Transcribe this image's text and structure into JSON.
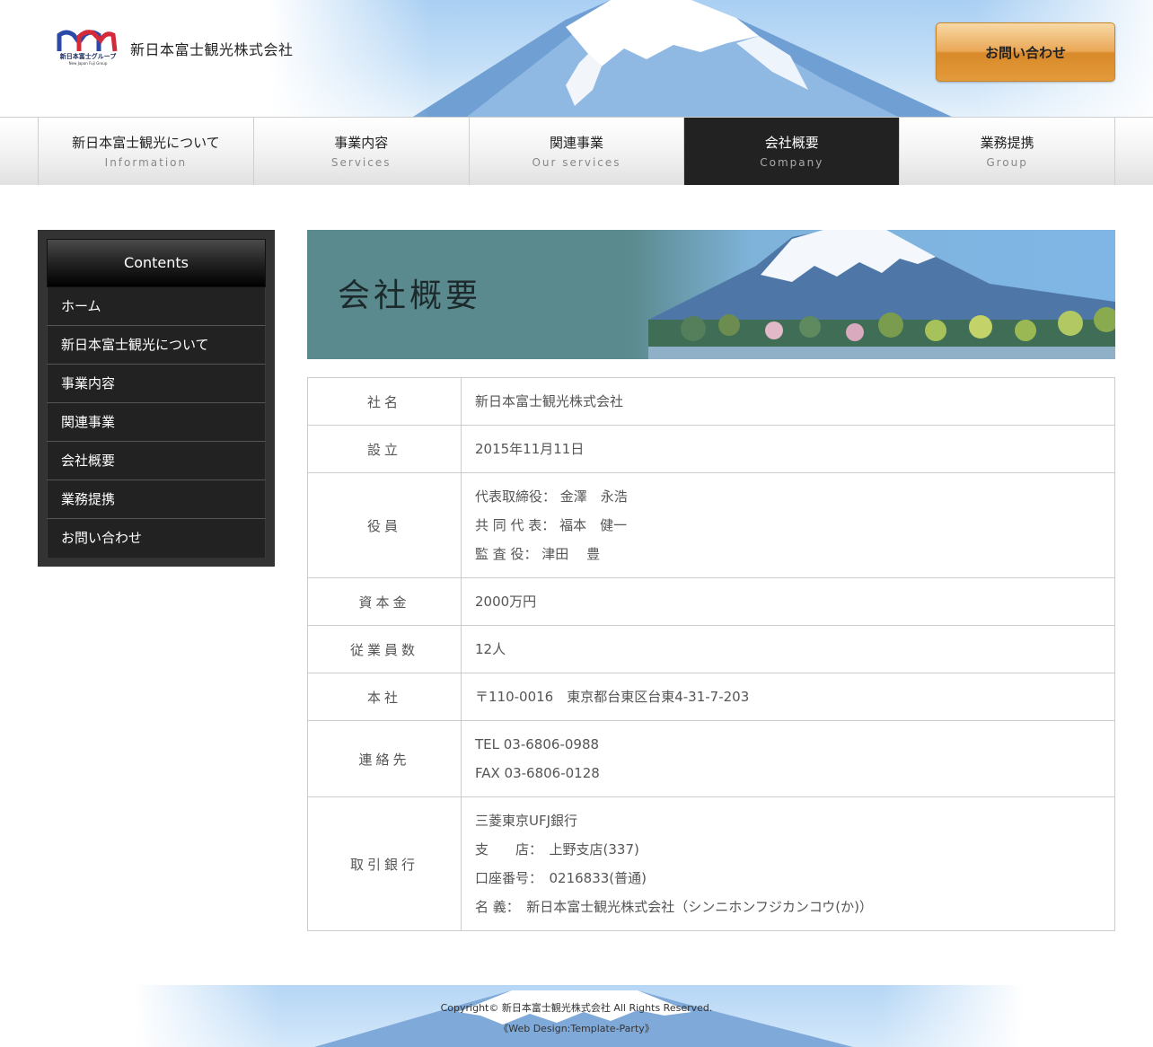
{
  "header": {
    "logo_text": "新日本富士グループ",
    "logo_subtext": "New Japan Fuji Group",
    "company_name": "新日本富士観光株式会社",
    "contact_button": "お問い合わせ"
  },
  "nav": [
    {
      "jp": "新日本富士観光について",
      "en": "Information",
      "active": false
    },
    {
      "jp": "事業内容",
      "en": "Services",
      "active": false
    },
    {
      "jp": "関連事業",
      "en": "Our services",
      "active": false
    },
    {
      "jp": "会社概要",
      "en": "Company",
      "active": true
    },
    {
      "jp": "業務提携",
      "en": "Group",
      "active": false
    }
  ],
  "sidebar": {
    "title": "Contents",
    "items": [
      "ホーム",
      "新日本富士観光について",
      "事業内容",
      "関連事業",
      "会社概要",
      "業務提携",
      "お問い合わせ"
    ]
  },
  "main": {
    "banner_title": "会社概要",
    "rows": [
      {
        "label": "社名",
        "lines": [
          "新日本富士観光株式会社"
        ]
      },
      {
        "label": "設立",
        "lines": [
          "2015年11月11日"
        ]
      },
      {
        "label": "役員",
        "lines": [
          "代表取締役： 金澤　永浩",
          "共 同 代 表： 福本　健一",
          "監 査 役： 津田　 豊"
        ]
      },
      {
        "label": "資本金",
        "lines": [
          "2000万円"
        ]
      },
      {
        "label": "従業員数",
        "lines": [
          "12人"
        ]
      },
      {
        "label": "本社",
        "lines": [
          "〒110-0016　東京都台東区台東4-31-7-203"
        ]
      },
      {
        "label": "連絡先",
        "lines": [
          "TEL 03-6806-0988",
          "FAX 03-6806-0128"
        ]
      },
      {
        "label": "取引銀行",
        "lines": [
          "三菱東京UFJ銀行",
          "支　　店：　上野支店(337)",
          "口座番号：　0216833(普通)",
          "名 義：　新日本富士観光株式会社（シンニホンフジカンコウ(か)）"
        ]
      }
    ]
  },
  "footer": {
    "copyright": "Copyright© 新日本富士観光株式会社 All Rights Reserved.",
    "credit": "《Web Design:Template-Party》"
  },
  "colors": {
    "accent_orange": "#e39a3a",
    "nav_active": "#222222",
    "banner_teal": "#5b8a8e",
    "logo_blue": "#2b4aa8",
    "logo_red": "#d42a3a"
  }
}
